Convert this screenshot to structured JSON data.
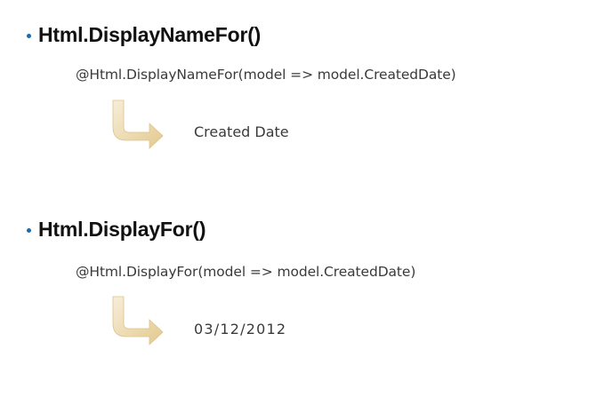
{
  "sections": [
    {
      "heading": "Html.DisplayNameFor()",
      "code": "@Html.DisplayNameFor(model => model.CreatedDate)",
      "result": "Created Date"
    },
    {
      "heading": "Html.DisplayFor()",
      "code": "@Html.DisplayFor(model => model.CreatedDate)",
      "result": "03/12/2012"
    }
  ],
  "colors": {
    "bullet": "#1a6cb0",
    "arrow_fill_light": "#f5ead0",
    "arrow_fill_dark": "#e6cf9c",
    "heading_text": "#111111",
    "body_text": "#3a3a3a"
  },
  "icons": {
    "bullet": "bullet-dot-icon",
    "arrow": "curved-down-right-arrow-icon"
  }
}
